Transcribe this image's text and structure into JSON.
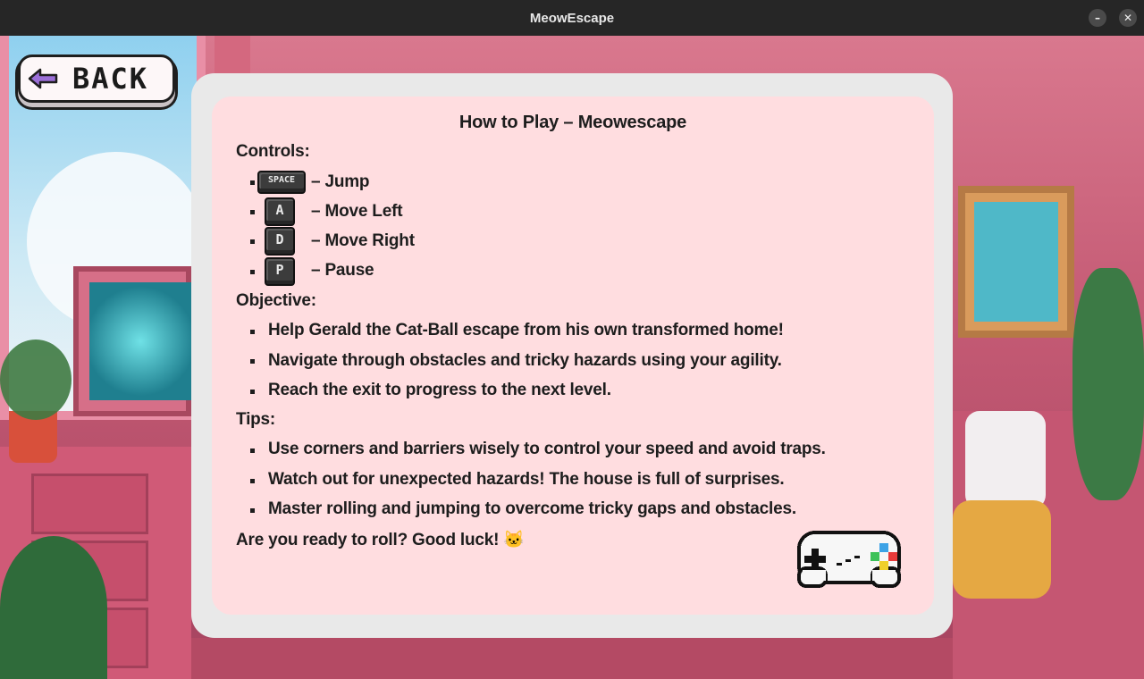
{
  "window": {
    "title": "MeowEscape",
    "minimize_glyph": "–",
    "close_glyph": "✕"
  },
  "back_button": {
    "label": "BACK",
    "icon": "left-arrow-icon"
  },
  "howto": {
    "title": "How to Play – Meowescape",
    "controls_heading": "Controls:",
    "controls": [
      {
        "key": "SPACE",
        "action": "– Jump"
      },
      {
        "key": "A",
        "action": "– Move Left"
      },
      {
        "key": "D",
        "action": "– Move Right"
      },
      {
        "key": "P",
        "action": "– Pause"
      }
    ],
    "objective_heading": "Objective:",
    "objectives": [
      "Help Gerald the Cat-Ball escape from his own transformed home!",
      "Navigate through obstacles and tricky hazards using your agility.",
      "Reach the exit to progress to the next level."
    ],
    "tips_heading": "Tips:",
    "tips": [
      "Use corners and barriers wisely to control your speed and avoid traps.",
      "Watch out for unexpected hazards! The house is full of surprises.",
      "Master rolling and jumping to overcome tricky gaps and obstacles."
    ],
    "closing": "Are you ready to roll? Good luck!",
    "closing_emoji": "🐱"
  },
  "icons": {
    "controller": "gamepad-icon",
    "cat": "cat-face-icon"
  },
  "colors": {
    "card_bg": "#ffdde0",
    "panel_bg": "#e9e9e9",
    "back_arrow": "#9b6fd8",
    "titlebar": "#262626"
  }
}
